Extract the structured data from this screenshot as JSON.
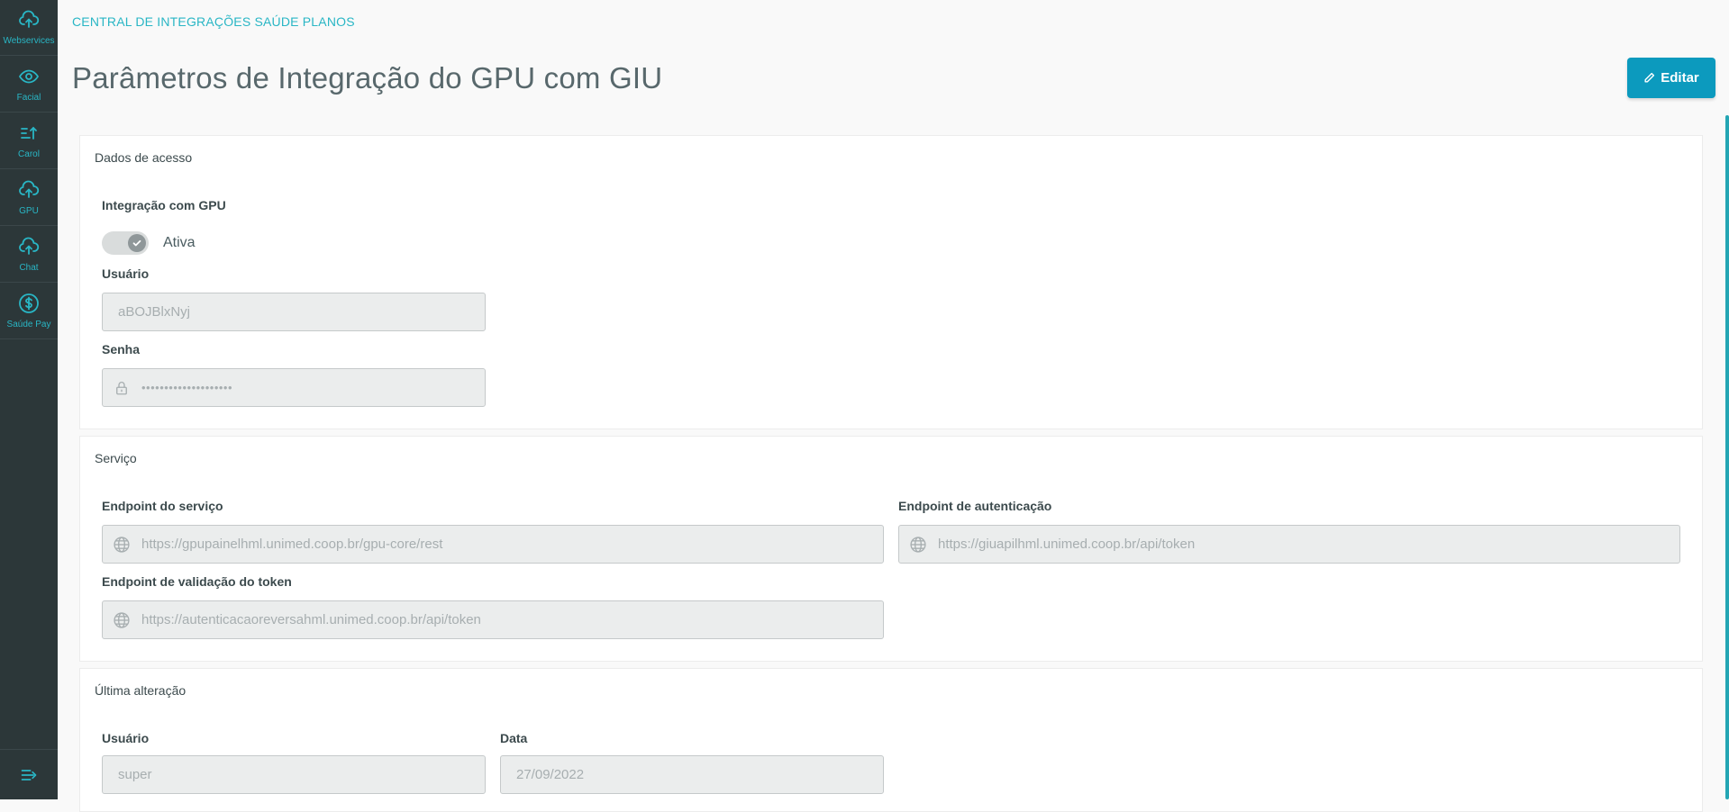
{
  "sidebar": {
    "items": [
      {
        "label": "Webservices",
        "icon": "cloud-upload-icon"
      },
      {
        "label": "Facial",
        "icon": "eye-icon"
      },
      {
        "label": "Carol",
        "icon": "sort-up-icon"
      },
      {
        "label": "GPU",
        "icon": "cloud-upload-icon"
      },
      {
        "label": "Chat",
        "icon": "cloud-upload-icon"
      },
      {
        "label": "Saúde Pay",
        "icon": "dollar-circle-icon"
      }
    ],
    "collapse_icon": "menu-collapse-icon"
  },
  "header": {
    "app_title": "CENTRAL DE INTEGRAÇÕES SAÚDE PLANOS",
    "page_title": "Parâmetros de Integração do GPU com GIU",
    "edit_label": "Editar"
  },
  "access": {
    "title": "Dados de acesso",
    "integration_label": "Integração com GPU",
    "toggle_state": "Ativa",
    "user_label": "Usuário",
    "user_value": "aBOJBlxNyj",
    "password_label": "Senha",
    "password_value": "••••••••••••••••••••"
  },
  "service": {
    "title": "Serviço",
    "endpoint_label": "Endpoint do serviço",
    "endpoint_value": "https://gpupainelhml.unimed.coop.br/gpu-core/rest",
    "auth_label": "Endpoint de autenticação",
    "auth_value": "https://giuapilhml.unimed.coop.br/api/token",
    "validation_label": "Endpoint de validação do token",
    "validation_value": "https://autenticacaoreversahml.unimed.coop.br/api/token"
  },
  "last_change": {
    "title": "Última alteração",
    "user_label": "Usuário",
    "user_value": "super",
    "date_label": "Data",
    "date_value": "27/09/2022"
  },
  "colors": {
    "sidebar_bg": "#2c3739",
    "accent": "#29b6c5",
    "button": "#0c9abe"
  }
}
